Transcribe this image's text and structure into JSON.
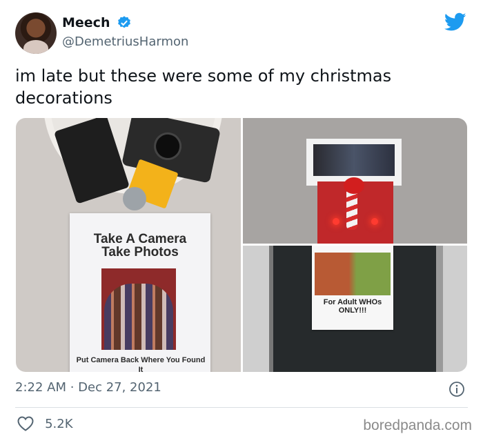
{
  "author": {
    "display_name": "Meech",
    "handle": "@DemetriusHarmon",
    "verified": true
  },
  "tweet": {
    "text": "im late but these were some of my christmas decorations",
    "timestamp": "2:22 AM · Dec 27, 2021",
    "likes": "5.2K"
  },
  "media": {
    "photo1": {
      "card_title": "Take A Camera\nTake Photos",
      "card_footer": "Put Camera Back Where You Found It\nWe'll get everything Developed"
    },
    "photo3": {
      "sign_caption": "For Adult WHOs ONLY!!!"
    }
  },
  "icons": {
    "verified": "verified-badge-icon",
    "twitter": "twitter-bird-icon",
    "info": "info-icon",
    "like": "heart-icon"
  },
  "colors": {
    "accent": "#1d9bf0",
    "text": "#0f1419",
    "secondary": "#536471"
  },
  "watermark": "boredpanda.com"
}
